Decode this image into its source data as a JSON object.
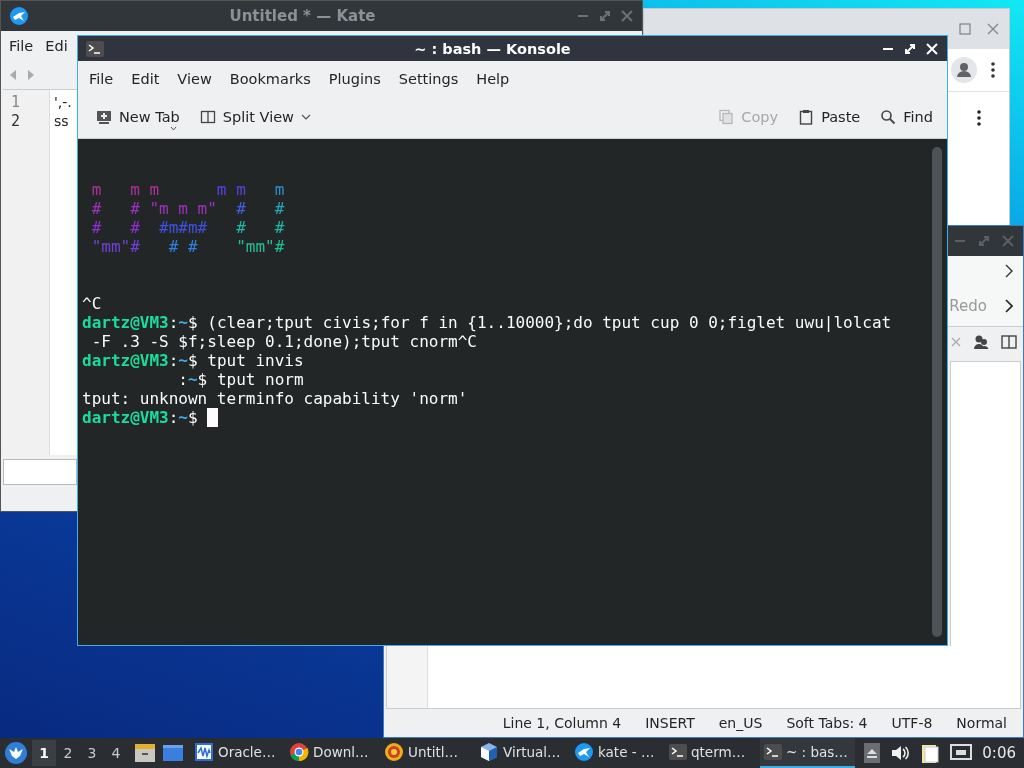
{
  "kate_window": {
    "title": "Untitled * — Kate",
    "menu": [
      "File",
      "Edi"
    ],
    "line_numbers": [
      "1",
      "2"
    ],
    "lines": [
      "',-.",
      "ss"
    ]
  },
  "kate_window_2": {
    "redo_label": "Redo",
    "status_bar": [
      "Line 1, Column 4",
      "INSERT",
      "en_US",
      "Soft Tabs: 4",
      "UTF-8",
      "Normal"
    ]
  },
  "konsole": {
    "title": "~ : bash — Konsole",
    "menu": [
      "File",
      "Edit",
      "View",
      "Bookmarks",
      "Plugins",
      "Settings",
      "Help"
    ],
    "toolbar_left": [
      {
        "label": "New Tab",
        "disabled": false
      },
      {
        "label": "Split View",
        "disabled": false
      }
    ],
    "toolbar_right": [
      {
        "label": "Copy",
        "disabled": true
      },
      {
        "label": "Paste",
        "disabled": false
      },
      {
        "label": "Find",
        "disabled": false
      }
    ],
    "terminal": {
      "art": [
        [
          {
            "text": "m   m m",
            "color": "#b0309a"
          },
          {
            "text": "      m m",
            "color": "#5a40e0"
          },
          {
            "text": "   m",
            "color": "#2a8fd0"
          }
        ],
        [
          {
            "text": "#   # \"m m m\"",
            "color": "#a030c0"
          },
          {
            "text": "  #",
            "color": "#4060e0"
          },
          {
            "text": "   #",
            "color": "#24a8c0"
          }
        ],
        [
          {
            "text": "#   #",
            "color": "#9030d0"
          },
          {
            "text": "  #m#m#",
            "color": "#4050e0"
          },
          {
            "text": "   #   #",
            "color": "#20b8a8"
          }
        ],
        [
          {
            "text": "\"mm\"#",
            "color": "#7040d8"
          },
          {
            "text": "   # #",
            "color": "#3080e0"
          },
          {
            "text": "    \"mm\"#",
            "color": "#20c090"
          }
        ]
      ],
      "lines": [
        {
          "kind": "output",
          "text": "^C"
        },
        {
          "kind": "prompt",
          "user": "dartz@VM3",
          "sep": ":",
          "path": "~",
          "symbol": "$",
          "command": "(clear;tput civis;for f in {1..10000};do tput cup 0 0;figlet uwu|lolcat"
        },
        {
          "kind": "output",
          "text": " -F .3 -S $f;sleep 0.1;done);tput cnorm^C"
        },
        {
          "kind": "prompt",
          "user": "dartz@VM3",
          "sep": ":",
          "path": "~",
          "symbol": "$",
          "command": "tput invis"
        },
        {
          "kind": "hidden_prompt",
          "sep": ":",
          "path": "~",
          "symbol": "$",
          "command": "tput norm"
        },
        {
          "kind": "output",
          "text": "tput: unknown terminfo capability 'norm'"
        },
        {
          "kind": "prompt",
          "user": "dartz@VM3",
          "sep": ":",
          "path": "~",
          "symbol": "$",
          "cursor": true
        }
      ]
    }
  },
  "taskbar": {
    "desktops": [
      {
        "label": "1",
        "selected": true
      },
      {
        "label": "2",
        "selected": false
      },
      {
        "label": "3",
        "selected": false
      },
      {
        "label": "4",
        "selected": false
      }
    ],
    "tasks": [
      {
        "label": "Oracle…",
        "selected": false
      },
      {
        "label": "Downl…",
        "selected": false
      },
      {
        "label": "Untitl…",
        "selected": false
      },
      {
        "label": "Virtual…",
        "selected": false
      },
      {
        "label": "kate - …",
        "selected": false
      },
      {
        "label": "qterm…",
        "selected": false
      },
      {
        "label": "~ : bas…",
        "selected": true
      }
    ],
    "clock": "0:06"
  }
}
